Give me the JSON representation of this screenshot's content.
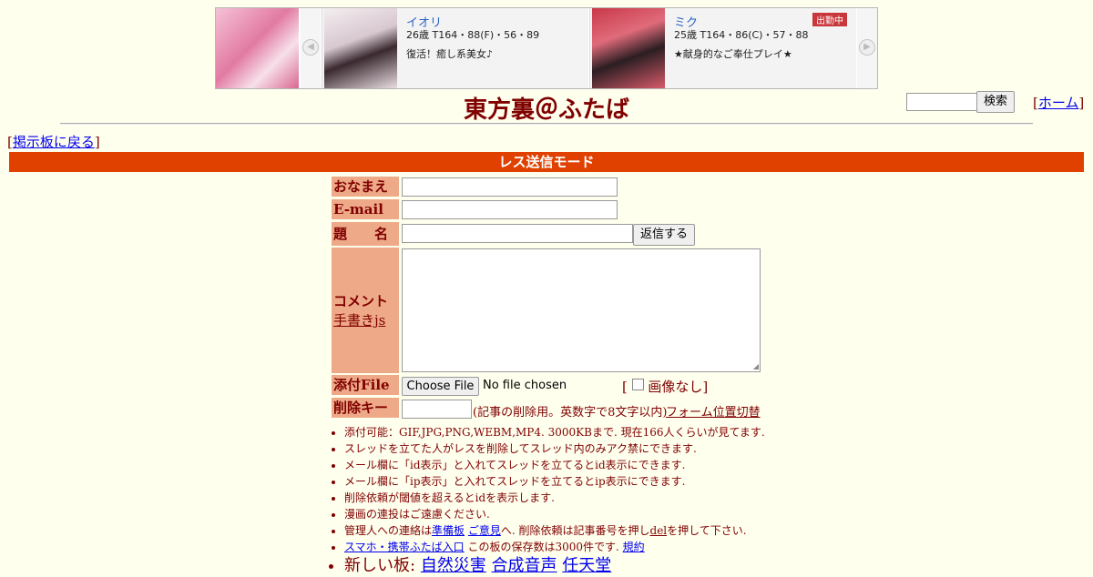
{
  "ad": {
    "cards": [
      {
        "name": "イオリ",
        "spec": "26歳 T164・88(F)・56・89",
        "message": "復活！癒し系美女♪",
        "badge": ""
      },
      {
        "name": "ミク",
        "spec": "25歳 T164・86(C)・57・88",
        "message": "★献身的なご奉仕プレイ★",
        "badge": "出勤中"
      }
    ]
  },
  "header": {
    "title": "東方裏＠ふたば",
    "search_button": "検索",
    "home_label": "ホーム",
    "back_label": "掲示板に戻る"
  },
  "mode_bar": "レス送信モード",
  "form": {
    "name_label": "おなまえ",
    "email_label": "E-mail",
    "subject_label": "題　　名",
    "submit_label": "返信する",
    "comment_label": "コメント",
    "handwrite_label": "手書きjs",
    "file_label": "添付File",
    "file_button": "Choose File",
    "file_status": "No file chosen",
    "no_image_label": "画像なし",
    "delkey_label": "削除キー",
    "delkey_note": "(記事の削除用。英数字で8文字以内)",
    "form_toggle": "フォーム位置切替"
  },
  "rules": {
    "r1": "添付可能：GIF,JPG,PNG,WEBM,MP4. 3000KBまで. 現在166人くらいが見てます.",
    "r2": "スレッドを立てた人がレスを削除してスレッド内のみアク禁にできます.",
    "r3": "メール欄に「id表示」と入れてスレッドを立てるとid表示にできます.",
    "r4": "メール欄に「ip表示」と入れてスレッドを立てるとip表示にできます.",
    "r5": "削除依頼が閾値を超えるとidを表示します.",
    "r6": "漫画の連投はご遠慮ください.",
    "r7_pre": "管理人への連絡は",
    "r7_link1": "準備板",
    "r7_link2": "ご意見",
    "r7_mid": "へ. 削除依頼は記事番号を押し",
    "r7_link3": "del",
    "r7_post": "を押して下さい.",
    "r8_link": "スマホ・携帯ふたば入口",
    "r8_text": "この板の保存数は3000件です.",
    "r8_link2": "規約",
    "r9_label": "新しい板:",
    "r9_boards": [
      "自然災害",
      "合成音声",
      "任天堂"
    ]
  },
  "colors": {
    "background": "#ffffee",
    "text": "#800000",
    "label_bg": "#eeaa88",
    "mode_bar": "#e04000"
  }
}
